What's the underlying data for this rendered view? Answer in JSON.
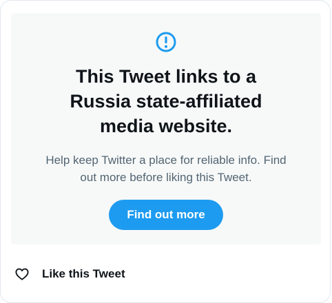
{
  "warning": {
    "icon": "exclamation-circle-icon",
    "accent_color": "#1d9bf0",
    "title_lines": [
      "This Tweet links to a",
      "Russia state-affiliated",
      "media website."
    ],
    "body_lines": [
      "Help keep Twitter a place for reliable info. Find",
      "out more before liking this Tweet."
    ],
    "cta_label": "Find out more"
  },
  "like": {
    "icon": "heart-outline-icon",
    "label": "Like this Tweet"
  }
}
